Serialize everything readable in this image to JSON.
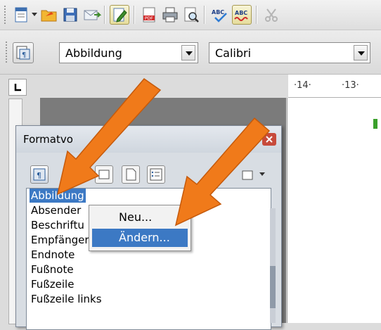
{
  "toolbar_standard": {
    "buttons": [
      "new-document-icon",
      "open-folder-icon",
      "save-icon",
      "email-icon",
      "edit-mode-icon",
      "export-pdf-icon",
      "print-icon",
      "page-preview-icon",
      "spellcheck-icon",
      "autospellcheck-icon",
      "cut-icon"
    ]
  },
  "toolbar_formatting": {
    "paragraph_style": "Abbildung",
    "font_name": "Calibri"
  },
  "ruler": {
    "labels": [
      "·14·",
      "·13·"
    ]
  },
  "styles_dialog": {
    "title": "Formatvorlagen",
    "title_visible": "Formatvo",
    "list": [
      "Abbildung",
      "Absender",
      "Beschriftung",
      "Empfänger",
      "Endnote",
      "Fußnote",
      "Fußzeile",
      "Fußzeile links"
    ],
    "list_visible": [
      "Abbildung",
      "Absender",
      "Beschriftu",
      "Empfänger",
      "Endnote",
      "Fußnote",
      "Fußzeile",
      "Fußzeile links"
    ],
    "selected_index": 0
  },
  "context_menu": {
    "items": [
      {
        "label": "Neu...",
        "highlighted": false
      },
      {
        "label": "Ändern...",
        "highlighted": true
      }
    ]
  },
  "colors": {
    "selection": "#3c79c4",
    "arrow": "#f07a1a",
    "toolbar_active": "#e6dd9c"
  }
}
